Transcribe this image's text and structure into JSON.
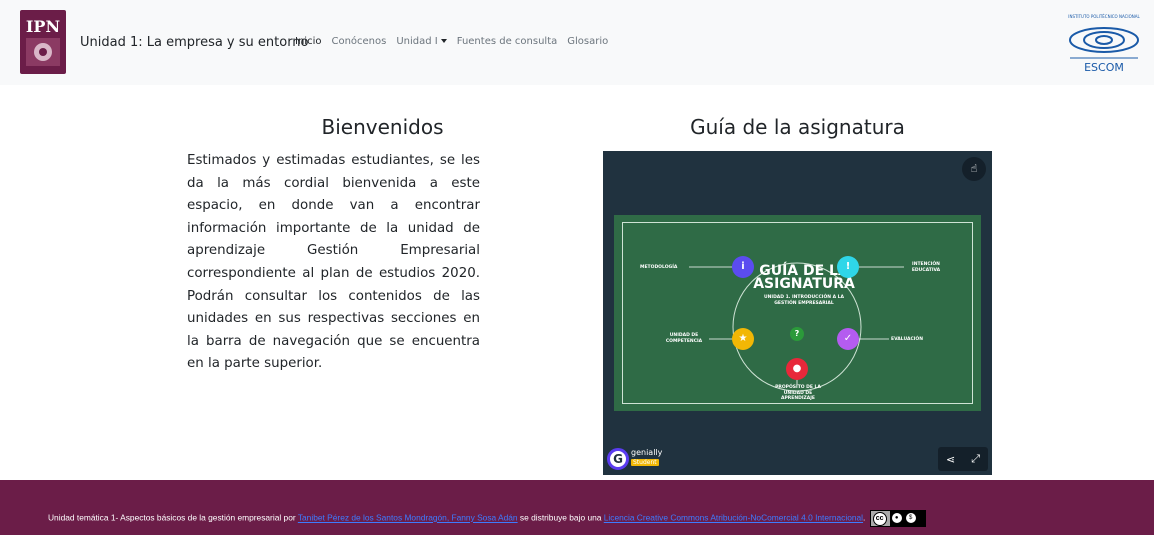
{
  "navbar": {
    "brand": "Unidad 1: La empresa y su entorno",
    "links": [
      {
        "label": "Inicio",
        "active": true
      },
      {
        "label": "Conócenos"
      },
      {
        "label": "Unidad I",
        "dropdown": true
      },
      {
        "label": "Fuentes de consulta"
      },
      {
        "label": "Glosario"
      }
    ],
    "ipn_logo_text": "IPN",
    "escom_logo_text": "ESCOM",
    "escom_caption": "INSTITUTO POLITÉCNICO NACIONAL"
  },
  "welcome": {
    "title": "Bienvenidos",
    "text": "Estimados y estimadas estudiantes, se les da la más cordial bienvenida a este espacio, en donde van a encontrar información importante de la unidad de aprendizaje Gestión Empresarial correspondiente al plan de estudios 2020. Podrán consultar los contenidos de las unidades en sus respectivas secciones en la barra de navegación que se encuentra en la parte superior."
  },
  "guide": {
    "title": "Guía de la asignatura",
    "board_title": "GUÍA DE LA ASIGNATURA",
    "board_subtitle": "UNIDAD 1. INTRODUCCIÓN A LA GESTIÓN EMPRESARIAL",
    "labels": {
      "metodologia": "METODOLOGÍA",
      "intencion": "INTENCIÓN EDUCATIVA",
      "competencia": "UNIDAD DE COMPETENCIA",
      "evaluacion": "EVALUACIÓN",
      "proposito": "PROPÓSITO DE LA UNIDAD DE APRENDIZAJE"
    },
    "genially_name": "genially",
    "genially_tag": "Student",
    "colors": {
      "board": "#2f6b46",
      "dot_info": "#5b4cf0",
      "dot_alert": "#2fd6e8",
      "dot_star": "#f2b705",
      "dot_check": "#b45cf0",
      "dot_pin": "#e8283a",
      "dot_question": "#2b9a3a"
    }
  },
  "footer": {
    "prefix": "Unidad temática 1- Aspectos básicos de la gestión empresarial por ",
    "authors": "Tanibet Pérez de los Santos Mondragón, Fanny Sosa Adán",
    "middle": " se distribuye bajo una ",
    "license": "Licencia Creative Commons Atribución-NoComercial 4.0 Internacional",
    "suffix": ".",
    "background": "#6b1d48"
  }
}
